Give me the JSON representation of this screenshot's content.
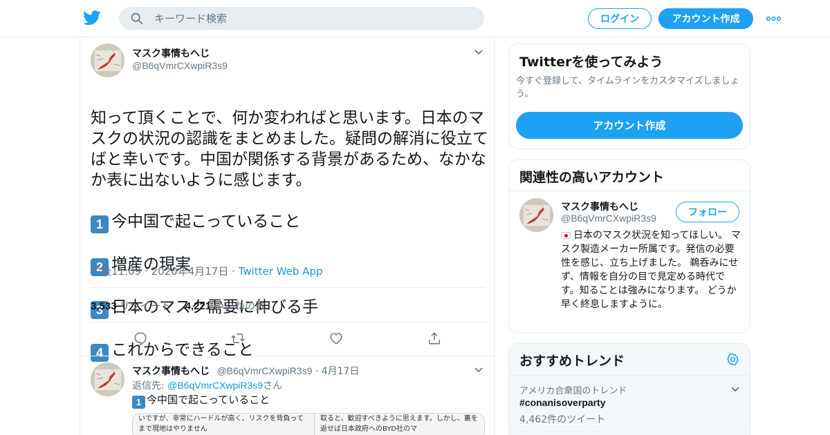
{
  "header": {
    "search_placeholder": "キーワード検索",
    "login_label": "ログイン",
    "signup_label": "アカウント作成"
  },
  "tweet": {
    "author_name": "マスク事情もへじ",
    "author_handle": "@B6qVmrCXwpiR3s9",
    "text_intro": "知って頂くことで、何か変わればと思います。日本のマスクの状況の認識をまとめました。疑問の解消に役立てばと幸いです。中国が関係する背景があるため、なかなか表に出ないように感じます。",
    "list_items": [
      {
        "num": "1",
        "text": "今中国で起こっていること"
      },
      {
        "num": "2",
        "text": "増産の現実"
      },
      {
        "num": "3",
        "text": "日本のマスク需要に伸びる手"
      },
      {
        "num": "4",
        "text": "これからできること"
      }
    ],
    "time": "午後11:09 · 2020年4月17日",
    "source": "Twitter Web App",
    "retweets_count": "3,533",
    "retweets_label": "リツイート",
    "likes_count": "4,221",
    "likes_label": "いいねの数"
  },
  "reply": {
    "author_name": "マスク事情もへじ",
    "author_handle": "@B6qVmrCXwpiR3s9",
    "date": "· 4月17日",
    "reply_to_prefix": "返信先: ",
    "reply_to_handle": "@B6qVmrCXwpiR3s9",
    "reply_to_suffix": "さん",
    "text_num": "1",
    "text": "今中国で起こっていること",
    "media_left": "いですが、非常にハードルが高く、リスクを背負ってまで現地はやりません",
    "media_right": "取ると、歓迎すべきように思えます。しかし、裏を返せば日本政府へのBYD社のマ"
  },
  "sidebar": {
    "signup_card": {
      "title": "Twitterを使ってみよう",
      "description": "今すぐ登録して、タイムラインをカスタマイズしましょう。",
      "button": "アカウント作成"
    },
    "related": {
      "title": "関連性の高いアカウント",
      "name": "マスク事情もへじ",
      "handle": "@B6qVmrCXwpiR3s9",
      "follow_label": "フォロー",
      "bio": "日本のマスク状況を知ってほしい。 マスク製造メーカー所属です。発信の必要性を感じ、立ち上げました。 鵜呑みにせず、情報を自分の目で見定める時代です。知ることは強みになります。 どうか早く終息しますように。"
    },
    "trends": {
      "title": "おすすめトレンド",
      "context": "アメリカ合衆国のトレンド",
      "name": "#conanisoverparty",
      "count": "4,462件のツイート"
    }
  },
  "colors": {
    "brand": "#1da1f2",
    "link": "#1b95e0",
    "muted": "#657786",
    "border": "#e6ecf0"
  }
}
